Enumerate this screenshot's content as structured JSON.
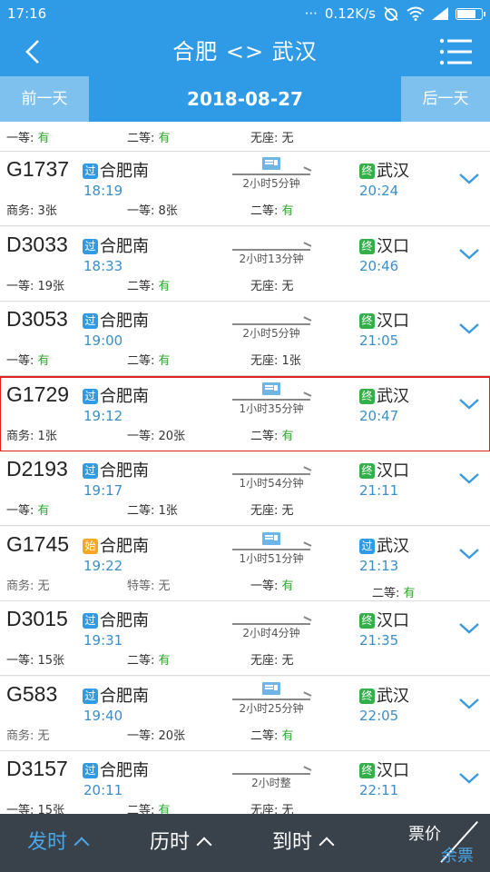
{
  "status": {
    "time": "17:16",
    "dots": "···",
    "network_speed": "0.12K/s",
    "battery_level": 0.78
  },
  "header": {
    "back_icon": "chevron-left-icon",
    "title": "合肥 <> 武汉",
    "menu_icon": "list-menu-icon"
  },
  "date_nav": {
    "prev_label": "前一天",
    "date": "2018-08-27",
    "next_label": "后一天"
  },
  "colors": {
    "primary": "#2f9be6",
    "via_badge": "#2f9be6",
    "start_badge": "#f5a623",
    "terminal_badge": "#34b04a",
    "available": "#2ea82e",
    "selected_outline": "#e0221e",
    "bottom_bar": "#39414a"
  },
  "top_partial_seats": [
    {
      "label": "一等: ",
      "value": "有",
      "avail": true
    },
    {
      "label": "二等: ",
      "value": "有",
      "avail": true
    },
    {
      "label": "无座: ",
      "value": "无",
      "avail": false
    }
  ],
  "trains": [
    {
      "no": "G1737",
      "from_badge": "过",
      "from_badge_type": "via",
      "from": "合肥南",
      "dep": "18:19",
      "duration": "2小时5分钟",
      "has_ticket_icon": true,
      "to_badge": "终",
      "to_badge_type": "terminal",
      "to": "武汉",
      "arr": "20:24",
      "seats": [
        {
          "label": "商务: ",
          "value": "3张",
          "avail": false
        },
        {
          "label": "一等: ",
          "value": "8张",
          "avail": false
        },
        {
          "label": "二等: ",
          "value": "有",
          "avail": true
        }
      ]
    },
    {
      "no": "D3033",
      "from_badge": "过",
      "from_badge_type": "via",
      "from": "合肥南",
      "dep": "18:33",
      "duration": "2小时13分钟",
      "has_ticket_icon": false,
      "to_badge": "终",
      "to_badge_type": "terminal",
      "to": "汉口",
      "arr": "20:46",
      "seats": [
        {
          "label": "一等: ",
          "value": "19张",
          "avail": false
        },
        {
          "label": "二等: ",
          "value": "有",
          "avail": true
        },
        {
          "label": "无座: ",
          "value": "无",
          "avail": false
        }
      ]
    },
    {
      "no": "D3053",
      "from_badge": "过",
      "from_badge_type": "via",
      "from": "合肥南",
      "dep": "19:00",
      "duration": "2小时5分钟",
      "has_ticket_icon": false,
      "to_badge": "终",
      "to_badge_type": "terminal",
      "to": "汉口",
      "arr": "21:05",
      "seats": [
        {
          "label": "一等: ",
          "value": "有",
          "avail": true
        },
        {
          "label": "二等: ",
          "value": "有",
          "avail": true
        },
        {
          "label": "无座: ",
          "value": "1张",
          "avail": false
        }
      ]
    },
    {
      "no": "G1729",
      "from_badge": "过",
      "from_badge_type": "via",
      "from": "合肥南",
      "dep": "19:12",
      "duration": "1小时35分钟",
      "has_ticket_icon": true,
      "selected": true,
      "to_badge": "终",
      "to_badge_type": "terminal",
      "to": "武汉",
      "arr": "20:47",
      "seats": [
        {
          "label": "商务: ",
          "value": "1张",
          "avail": false
        },
        {
          "label": "一等: ",
          "value": "20张",
          "avail": false
        },
        {
          "label": "二等: ",
          "value": "有",
          "avail": true
        }
      ]
    },
    {
      "no": "D2193",
      "from_badge": "过",
      "from_badge_type": "via",
      "from": "合肥南",
      "dep": "19:17",
      "duration": "1小时54分钟",
      "has_ticket_icon": false,
      "to_badge": "终",
      "to_badge_type": "terminal",
      "to": "汉口",
      "arr": "21:11",
      "seats": [
        {
          "label": "一等: ",
          "value": "有",
          "avail": true
        },
        {
          "label": "二等: ",
          "value": "1张",
          "avail": false
        },
        {
          "label": "无座: ",
          "value": "无",
          "avail": false
        }
      ]
    },
    {
      "no": "G1745",
      "from_badge": "始",
      "from_badge_type": "start",
      "from": "合肥南",
      "dep": "19:22",
      "duration": "1小时51分钟",
      "has_ticket_icon": true,
      "to_badge": "过",
      "to_badge_type": "via",
      "to": "武汉",
      "arr": "21:13",
      "seats": [
        {
          "label": "商务: ",
          "value": "无",
          "avail": false,
          "muted": true
        },
        {
          "label": "特等: ",
          "value": "无",
          "avail": false,
          "muted": true
        },
        {
          "label": "一等: ",
          "value": "有",
          "avail": true
        },
        {
          "label": "二等: ",
          "value": "有",
          "avail": true
        }
      ]
    },
    {
      "no": "D3015",
      "from_badge": "过",
      "from_badge_type": "via",
      "from": "合肥南",
      "dep": "19:31",
      "duration": "2小时4分钟",
      "has_ticket_icon": false,
      "to_badge": "终",
      "to_badge_type": "terminal",
      "to": "汉口",
      "arr": "21:35",
      "seats": [
        {
          "label": "一等: ",
          "value": "15张",
          "avail": false
        },
        {
          "label": "二等: ",
          "value": "有",
          "avail": true
        },
        {
          "label": "无座: ",
          "value": "无",
          "avail": false
        }
      ]
    },
    {
      "no": "G583",
      "from_badge": "过",
      "from_badge_type": "via",
      "from": "合肥南",
      "dep": "19:40",
      "duration": "2小时25分钟",
      "has_ticket_icon": true,
      "to_badge": "终",
      "to_badge_type": "terminal",
      "to": "武汉",
      "arr": "22:05",
      "seats": [
        {
          "label": "商务: ",
          "value": "无",
          "avail": false,
          "muted": true
        },
        {
          "label": "一等: ",
          "value": "20张",
          "avail": false
        },
        {
          "label": "二等: ",
          "value": "有",
          "avail": true
        }
      ]
    },
    {
      "no": "D3157",
      "from_badge": "过",
      "from_badge_type": "via",
      "from": "合肥南",
      "dep": "20:11",
      "duration": "2小时整",
      "has_ticket_icon": false,
      "to_badge": "终",
      "to_badge_type": "terminal",
      "to": "汉口",
      "arr": "22:11",
      "seats": [
        {
          "label": "一等: ",
          "value": "15张",
          "avail": false
        },
        {
          "label": "二等: ",
          "value": "有",
          "avail": true
        },
        {
          "label": "无座: ",
          "value": "无",
          "avail": false
        }
      ]
    }
  ],
  "bottom_bar": {
    "sort_depart": "发时",
    "sort_duration": "历时",
    "sort_arrive": "到时",
    "price_label": "票价",
    "remain_label": "余票"
  }
}
